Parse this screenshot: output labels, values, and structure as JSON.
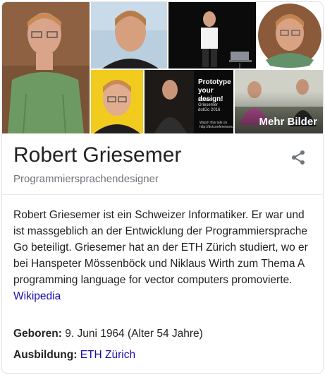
{
  "images": {
    "more_label": "Mehr Bilder",
    "slide_title": "Prototype your design!",
    "slide_author": "Robert Griesemer dotGo 2016",
    "slide_url": "Watch this talk on http://dotconferences.com"
  },
  "entity": {
    "name": "Robert Griesemer",
    "type": "Programmiersprachendesigner"
  },
  "description": {
    "text": "Robert Griesemer ist ein Schweizer Informatiker. Er war und ist massgeblich an der Entwicklung der Programmiersprache Go beteiligt. Griesemer hat an der ETH Zürich studiert, wo er bei Hanspeter Mössenböck und Niklaus Wirth zum Thema A programming language for vector computers promovierte.",
    "source_link": "Wikipedia"
  },
  "facts": [
    {
      "label": "Geboren:",
      "value": "9. Juni 1964 (Alter 54 Jahre)"
    },
    {
      "label": "Ausbildung:",
      "value": "ETH Zürich"
    }
  ],
  "icons": {
    "share": "share-icon"
  },
  "colors": {
    "link": "#1a0dab",
    "subtitle": "#70757a",
    "text": "#222222"
  }
}
